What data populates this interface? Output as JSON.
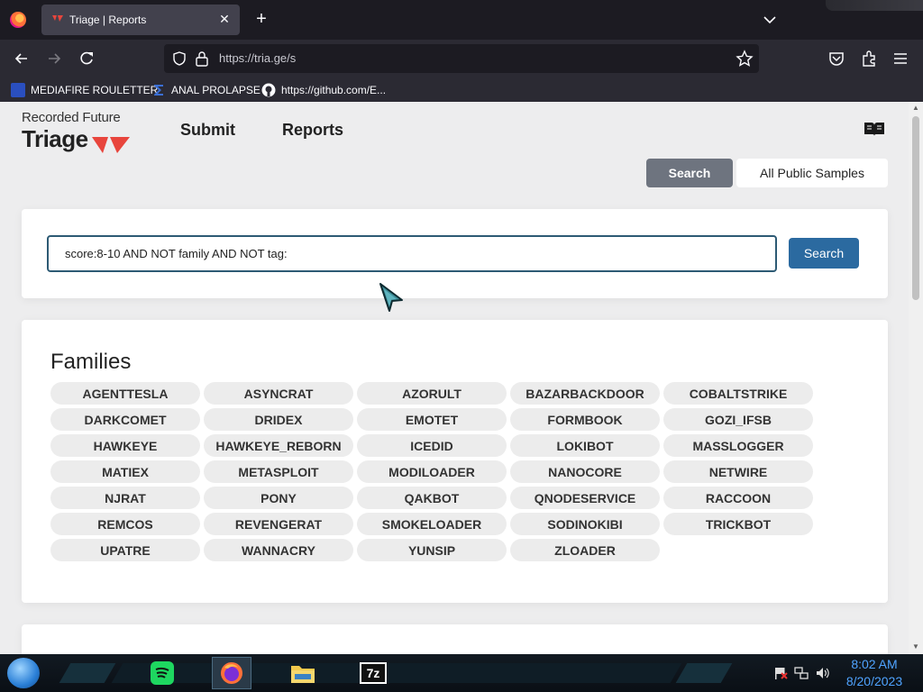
{
  "browser": {
    "tab_title": "Triage | Reports",
    "tab_close": "✕",
    "new_tab": "+",
    "url": "https://tria.ge/s",
    "bookmarks": [
      {
        "label": "MEDIAFIRE ROULETTER"
      },
      {
        "label": "ANAL PROLAPSE"
      },
      {
        "label": "https://github.com/E..."
      }
    ]
  },
  "header": {
    "brand_top": "Recorded Future",
    "brand_main": "Triage",
    "nav": [
      {
        "label": "Submit"
      },
      {
        "label": "Reports"
      }
    ],
    "docs_icon": "book-icon"
  },
  "view_toggle": {
    "active": "Search",
    "inactive": "All Public Samples"
  },
  "search": {
    "query": "score:8-10 AND NOT family AND NOT tag:",
    "button": "Search"
  },
  "families": {
    "title": "Families",
    "items": [
      "AGENTTESLA",
      "ASYNCRAT",
      "AZORULT",
      "BAZARBACKDOOR",
      "COBALTSTRIKE",
      "DARKCOMET",
      "DRIDEX",
      "EMOTET",
      "FORMBOOK",
      "GOZI_IFSB",
      "HAWKEYE",
      "HAWKEYE_REBORN",
      "ICEDID",
      "LOKIBOT",
      "MASSLOGGER",
      "MATIEX",
      "METASPLOIT",
      "MODILOADER",
      "NANOCORE",
      "NETWIRE",
      "NJRAT",
      "PONY",
      "QAKBOT",
      "QNODESERVICE",
      "RACCOON",
      "REMCOS",
      "REVENGERAT",
      "SMOKELOADER",
      "SODINOKIBI",
      "TRICKBOT",
      "UPATRE",
      "WANNACRY",
      "YUNSIP",
      "ZLOADER"
    ]
  },
  "taskbar": {
    "time": "8:02 AM",
    "date": "8/20/2023",
    "apps": [
      "spotify-icon",
      "firefox-icon",
      "file-explorer-icon",
      "7zip-icon"
    ]
  },
  "colors": {
    "search_button": "#2b6aa0",
    "active_toggle": "#6e747f",
    "input_border": "#2d5a74",
    "brand_red": "#e8453c",
    "clock_text": "#4fa3ff"
  }
}
